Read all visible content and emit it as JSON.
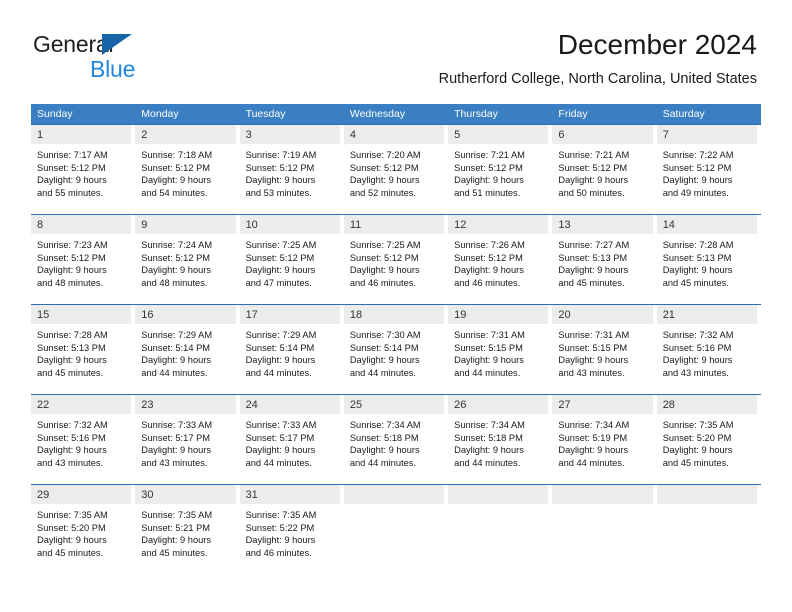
{
  "brand": {
    "name_dark": "General",
    "name_light": "Blue",
    "triangle_color": "#1565a8",
    "blue_color": "#1f87dd"
  },
  "header": {
    "month_title": "December 2024",
    "location": "Rutherford College, North Carolina, United States"
  },
  "theme": {
    "header_bg": "#3a7fc1",
    "row_border": "#2e6daf",
    "daynum_band_bg": "#ececec",
    "text": "#1a1a1a"
  },
  "calendar": {
    "weekdays": [
      "Sunday",
      "Monday",
      "Tuesday",
      "Wednesday",
      "Thursday",
      "Friday",
      "Saturday"
    ],
    "weeks": [
      [
        {
          "day": "1",
          "sunrise": "Sunrise: 7:17 AM",
          "sunset": "Sunset: 5:12 PM",
          "daylight1": "Daylight: 9 hours",
          "daylight2": "and 55 minutes."
        },
        {
          "day": "2",
          "sunrise": "Sunrise: 7:18 AM",
          "sunset": "Sunset: 5:12 PM",
          "daylight1": "Daylight: 9 hours",
          "daylight2": "and 54 minutes."
        },
        {
          "day": "3",
          "sunrise": "Sunrise: 7:19 AM",
          "sunset": "Sunset: 5:12 PM",
          "daylight1": "Daylight: 9 hours",
          "daylight2": "and 53 minutes."
        },
        {
          "day": "4",
          "sunrise": "Sunrise: 7:20 AM",
          "sunset": "Sunset: 5:12 PM",
          "daylight1": "Daylight: 9 hours",
          "daylight2": "and 52 minutes."
        },
        {
          "day": "5",
          "sunrise": "Sunrise: 7:21 AM",
          "sunset": "Sunset: 5:12 PM",
          "daylight1": "Daylight: 9 hours",
          "daylight2": "and 51 minutes."
        },
        {
          "day": "6",
          "sunrise": "Sunrise: 7:21 AM",
          "sunset": "Sunset: 5:12 PM",
          "daylight1": "Daylight: 9 hours",
          "daylight2": "and 50 minutes."
        },
        {
          "day": "7",
          "sunrise": "Sunrise: 7:22 AM",
          "sunset": "Sunset: 5:12 PM",
          "daylight1": "Daylight: 9 hours",
          "daylight2": "and 49 minutes."
        }
      ],
      [
        {
          "day": "8",
          "sunrise": "Sunrise: 7:23 AM",
          "sunset": "Sunset: 5:12 PM",
          "daylight1": "Daylight: 9 hours",
          "daylight2": "and 48 minutes."
        },
        {
          "day": "9",
          "sunrise": "Sunrise: 7:24 AM",
          "sunset": "Sunset: 5:12 PM",
          "daylight1": "Daylight: 9 hours",
          "daylight2": "and 48 minutes."
        },
        {
          "day": "10",
          "sunrise": "Sunrise: 7:25 AM",
          "sunset": "Sunset: 5:12 PM",
          "daylight1": "Daylight: 9 hours",
          "daylight2": "and 47 minutes."
        },
        {
          "day": "11",
          "sunrise": "Sunrise: 7:25 AM",
          "sunset": "Sunset: 5:12 PM",
          "daylight1": "Daylight: 9 hours",
          "daylight2": "and 46 minutes."
        },
        {
          "day": "12",
          "sunrise": "Sunrise: 7:26 AM",
          "sunset": "Sunset: 5:12 PM",
          "daylight1": "Daylight: 9 hours",
          "daylight2": "and 46 minutes."
        },
        {
          "day": "13",
          "sunrise": "Sunrise: 7:27 AM",
          "sunset": "Sunset: 5:13 PM",
          "daylight1": "Daylight: 9 hours",
          "daylight2": "and 45 minutes."
        },
        {
          "day": "14",
          "sunrise": "Sunrise: 7:28 AM",
          "sunset": "Sunset: 5:13 PM",
          "daylight1": "Daylight: 9 hours",
          "daylight2": "and 45 minutes."
        }
      ],
      [
        {
          "day": "15",
          "sunrise": "Sunrise: 7:28 AM",
          "sunset": "Sunset: 5:13 PM",
          "daylight1": "Daylight: 9 hours",
          "daylight2": "and 45 minutes."
        },
        {
          "day": "16",
          "sunrise": "Sunrise: 7:29 AM",
          "sunset": "Sunset: 5:14 PM",
          "daylight1": "Daylight: 9 hours",
          "daylight2": "and 44 minutes."
        },
        {
          "day": "17",
          "sunrise": "Sunrise: 7:29 AM",
          "sunset": "Sunset: 5:14 PM",
          "daylight1": "Daylight: 9 hours",
          "daylight2": "and 44 minutes."
        },
        {
          "day": "18",
          "sunrise": "Sunrise: 7:30 AM",
          "sunset": "Sunset: 5:14 PM",
          "daylight1": "Daylight: 9 hours",
          "daylight2": "and 44 minutes."
        },
        {
          "day": "19",
          "sunrise": "Sunrise: 7:31 AM",
          "sunset": "Sunset: 5:15 PM",
          "daylight1": "Daylight: 9 hours",
          "daylight2": "and 44 minutes."
        },
        {
          "day": "20",
          "sunrise": "Sunrise: 7:31 AM",
          "sunset": "Sunset: 5:15 PM",
          "daylight1": "Daylight: 9 hours",
          "daylight2": "and 43 minutes."
        },
        {
          "day": "21",
          "sunrise": "Sunrise: 7:32 AM",
          "sunset": "Sunset: 5:16 PM",
          "daylight1": "Daylight: 9 hours",
          "daylight2": "and 43 minutes."
        }
      ],
      [
        {
          "day": "22",
          "sunrise": "Sunrise: 7:32 AM",
          "sunset": "Sunset: 5:16 PM",
          "daylight1": "Daylight: 9 hours",
          "daylight2": "and 43 minutes."
        },
        {
          "day": "23",
          "sunrise": "Sunrise: 7:33 AM",
          "sunset": "Sunset: 5:17 PM",
          "daylight1": "Daylight: 9 hours",
          "daylight2": "and 43 minutes."
        },
        {
          "day": "24",
          "sunrise": "Sunrise: 7:33 AM",
          "sunset": "Sunset: 5:17 PM",
          "daylight1": "Daylight: 9 hours",
          "daylight2": "and 44 minutes."
        },
        {
          "day": "25",
          "sunrise": "Sunrise: 7:34 AM",
          "sunset": "Sunset: 5:18 PM",
          "daylight1": "Daylight: 9 hours",
          "daylight2": "and 44 minutes."
        },
        {
          "day": "26",
          "sunrise": "Sunrise: 7:34 AM",
          "sunset": "Sunset: 5:18 PM",
          "daylight1": "Daylight: 9 hours",
          "daylight2": "and 44 minutes."
        },
        {
          "day": "27",
          "sunrise": "Sunrise: 7:34 AM",
          "sunset": "Sunset: 5:19 PM",
          "daylight1": "Daylight: 9 hours",
          "daylight2": "and 44 minutes."
        },
        {
          "day": "28",
          "sunrise": "Sunrise: 7:35 AM",
          "sunset": "Sunset: 5:20 PM",
          "daylight1": "Daylight: 9 hours",
          "daylight2": "and 45 minutes."
        }
      ],
      [
        {
          "day": "29",
          "sunrise": "Sunrise: 7:35 AM",
          "sunset": "Sunset: 5:20 PM",
          "daylight1": "Daylight: 9 hours",
          "daylight2": "and 45 minutes."
        },
        {
          "day": "30",
          "sunrise": "Sunrise: 7:35 AM",
          "sunset": "Sunset: 5:21 PM",
          "daylight1": "Daylight: 9 hours",
          "daylight2": "and 45 minutes."
        },
        {
          "day": "31",
          "sunrise": "Sunrise: 7:35 AM",
          "sunset": "Sunset: 5:22 PM",
          "daylight1": "Daylight: 9 hours",
          "daylight2": "and 46 minutes."
        },
        {
          "day": "",
          "sunrise": "",
          "sunset": "",
          "daylight1": "",
          "daylight2": ""
        },
        {
          "day": "",
          "sunrise": "",
          "sunset": "",
          "daylight1": "",
          "daylight2": ""
        },
        {
          "day": "",
          "sunrise": "",
          "sunset": "",
          "daylight1": "",
          "daylight2": ""
        },
        {
          "day": "",
          "sunrise": "",
          "sunset": "",
          "daylight1": "",
          "daylight2": ""
        }
      ]
    ]
  }
}
